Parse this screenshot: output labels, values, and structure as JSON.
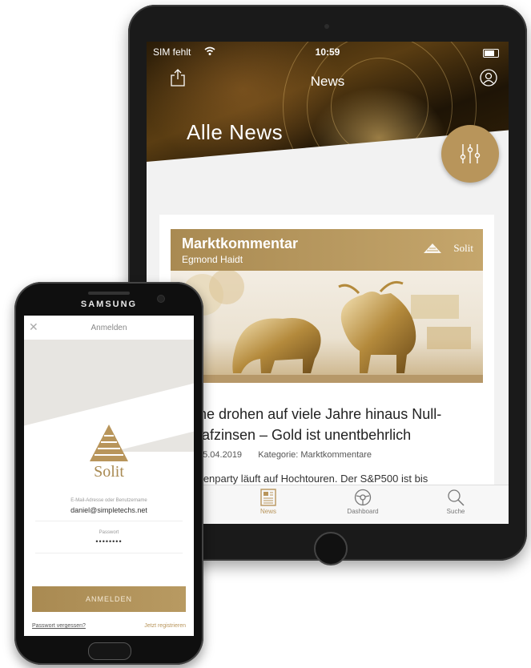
{
  "tablet": {
    "status": {
      "carrier": "SIM fehlt",
      "time": "10:59"
    },
    "nav_title": "News",
    "hero_title": "Alle News",
    "card": {
      "category": "Marktkommentar",
      "author": "Egmond Haidt",
      "brand": "Solit",
      "headline_line1": "zone drohen auf viele Jahre hinaus Null-",
      "headline_line2": "Strafzinsen – Gold ist unentbehrlich",
      "date": "15.04.2019",
      "category_meta": "Kategorie: Marktkommentare",
      "excerpt": "rsenparty läuft auf Hochtouren. Der S&P500 ist bis"
    },
    "tabs": [
      {
        "label": "News",
        "icon": "news-icon"
      },
      {
        "label": "Dashboard",
        "icon": "dashboard-icon"
      },
      {
        "label": "Suche",
        "icon": "search-icon"
      }
    ],
    "accent": "#b8955b"
  },
  "phone": {
    "brand": "SAMSUNG",
    "header_title": "Anmelden",
    "logo_text": "Solit",
    "username_label": "E-Mail-Adresse oder Benutzername",
    "username_value": "daniel@simpletechs.net",
    "password_label": "Passwort",
    "password_value": "••••••••",
    "login_button": "ANMELDEN",
    "forgot_link": "Passwort vergessen?",
    "register_link": "Jetzt registrieren"
  }
}
